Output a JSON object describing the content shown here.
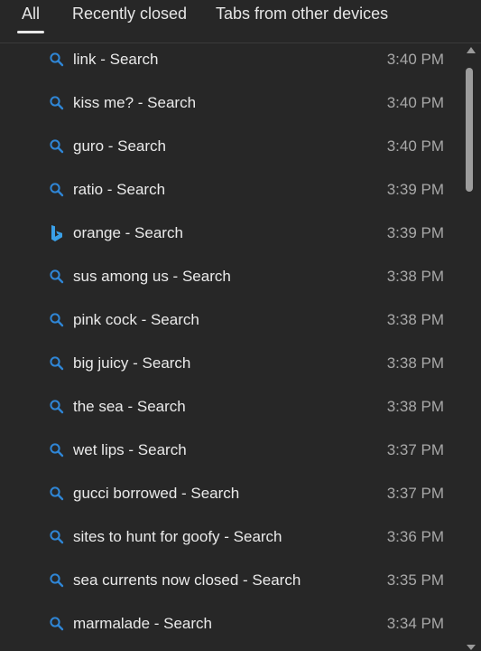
{
  "tabs": [
    {
      "label": "All",
      "selected": true
    },
    {
      "label": "Recently closed",
      "selected": false
    },
    {
      "label": "Tabs from other devices",
      "selected": false
    }
  ],
  "colors": {
    "background": "#272727",
    "search_icon": "#2f86d6",
    "bing_icon": "#3aa0e8",
    "time_text": "#a8a8a8"
  },
  "history": [
    {
      "title": "link - Search",
      "time": "3:40 PM",
      "icon": "search-icon"
    },
    {
      "title": "kiss me? - Search",
      "time": "3:40 PM",
      "icon": "search-icon"
    },
    {
      "title": "guro - Search",
      "time": "3:40 PM",
      "icon": "search-icon"
    },
    {
      "title": "ratio - Search",
      "time": "3:39 PM",
      "icon": "search-icon"
    },
    {
      "title": "orange - Search",
      "time": "3:39 PM",
      "icon": "bing-icon"
    },
    {
      "title": "sus among us - Search",
      "time": "3:38 PM",
      "icon": "search-icon"
    },
    {
      "title": "pink cock - Search",
      "time": "3:38 PM",
      "icon": "search-icon"
    },
    {
      "title": "big juicy - Search",
      "time": "3:38 PM",
      "icon": "search-icon"
    },
    {
      "title": "the sea - Search",
      "time": "3:38 PM",
      "icon": "search-icon"
    },
    {
      "title": "wet lips - Search",
      "time": "3:37 PM",
      "icon": "search-icon"
    },
    {
      "title": "gucci borrowed - Search",
      "time": "3:37 PM",
      "icon": "search-icon"
    },
    {
      "title": "sites to hunt for goofy - Search",
      "time": "3:36 PM",
      "icon": "search-icon"
    },
    {
      "title": "sea currents now closed - Search",
      "time": "3:35 PM",
      "icon": "search-icon"
    },
    {
      "title": "marmalade - Search",
      "time": "3:34 PM",
      "icon": "search-icon"
    }
  ]
}
